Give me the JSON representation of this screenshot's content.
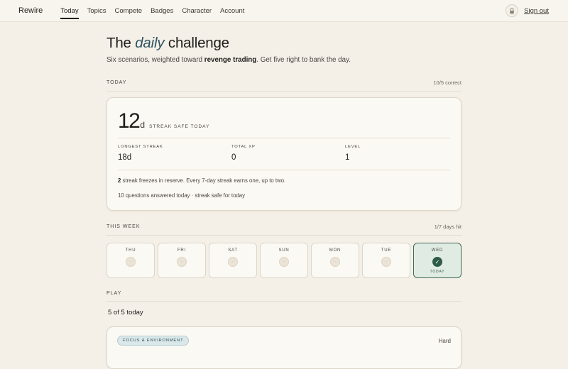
{
  "brand": "Rewire",
  "nav": {
    "items": [
      {
        "label": "Today"
      },
      {
        "label": "Topics"
      },
      {
        "label": "Compete"
      },
      {
        "label": "Badges"
      },
      {
        "label": "Character"
      },
      {
        "label": "Account"
      }
    ],
    "active_index": 0
  },
  "header_actions": {
    "avatar_icon": "lock-icon",
    "signout_label": "Sign out"
  },
  "page": {
    "title_before": "The ",
    "title_accent": "daily",
    "title_after": " challenge",
    "subtitle_before": "Six scenarios, weighted toward ",
    "subtitle_bold": "revenge trading",
    "subtitle_after": ". Get five right to bank the day."
  },
  "today": {
    "section_label": "TODAY",
    "correct_text": "10/5 correct",
    "streak_value": "12",
    "streak_unit": "d",
    "streak_caption": "STREAK SAFE TODAY",
    "stats": [
      {
        "label": "LONGEST STREAK",
        "value": "18d"
      },
      {
        "label": "TOTAL XP",
        "value": "0"
      },
      {
        "label": "LEVEL",
        "value": "1"
      }
    ],
    "freeze_count": "2",
    "freeze_text": " streak freezes in reserve. Every 7-day streak earns one, up to two.",
    "answered_text": "10 questions answered today · streak safe for today"
  },
  "week": {
    "section_label": "THIS WEEK",
    "days_hit_text": "1/7 days hit",
    "days": [
      {
        "label": "THU",
        "mark": "·",
        "is_today": false
      },
      {
        "label": "FRI",
        "mark": "·",
        "is_today": false
      },
      {
        "label": "SAT",
        "mark": "·",
        "is_today": false
      },
      {
        "label": "SUN",
        "mark": "·",
        "is_today": false
      },
      {
        "label": "MON",
        "mark": "·",
        "is_today": false
      },
      {
        "label": "TUE",
        "mark": "·",
        "is_today": false
      },
      {
        "label": "WED",
        "mark": "✓",
        "is_today": true,
        "today_tag": "TODAY"
      }
    ]
  },
  "play": {
    "section_label": "PLAY",
    "progress_text": "5 of 5 today",
    "question": {
      "topic": "FOCUS & ENVIRONMENT",
      "difficulty": "Hard"
    }
  },
  "colors": {
    "background": "#f4f0e8",
    "accent_title": "#2e5561",
    "today_green": "#2f5c49",
    "today_bg": "#e0ece3",
    "badge_bg": "#dbe8ea"
  }
}
